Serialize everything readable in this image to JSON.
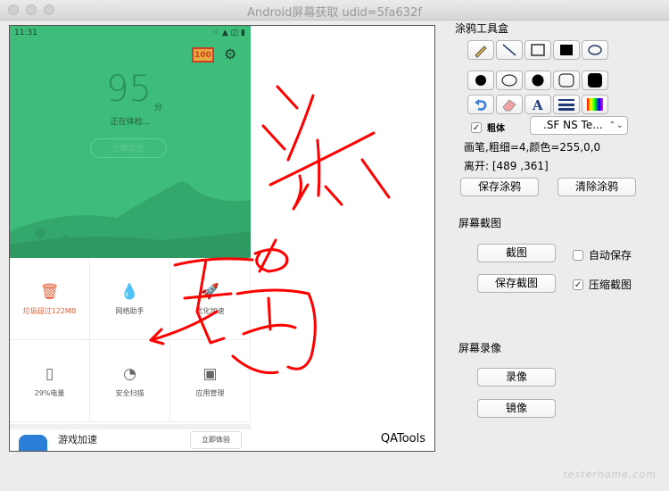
{
  "window": {
    "title": "Android屏幕获取 udid=5fa632f"
  },
  "phone": {
    "time": "11:31",
    "status_icons": "⁘ ▲ ◫ ▮",
    "badge": "100",
    "score": "95",
    "score_unit": "分",
    "checking": "正在体检...",
    "optimize_btn": "立即优化",
    "tiles": [
      {
        "label": "垃圾超过122MB",
        "icon": "trash-icon"
      },
      {
        "label": "网络助手",
        "icon": "drop-icon"
      },
      {
        "label": "优化加速",
        "icon": "rocket-icon"
      },
      {
        "label": "29%电量",
        "icon": "battery-icon"
      },
      {
        "label": "安全扫描",
        "icon": "scan-icon"
      },
      {
        "label": "应用管理",
        "icon": "android-icon"
      }
    ],
    "game": {
      "label": "游戏加速",
      "btn": "立即体验"
    }
  },
  "canvas": {
    "watermark": "QATools"
  },
  "toolbox": {
    "title": "涂鸦工具盒",
    "bold_label": "粗体",
    "bold_checked": true,
    "font_select": ".SF NS Te...",
    "pen_info": "画笔,粗细=4,颜色=255,0,0",
    "leave_info": "离开: [489 ,361]",
    "save_doodle": "保存涂鸦",
    "clear_doodle": "清除涂鸦"
  },
  "screenshot": {
    "title": "屏幕截图",
    "capture": "截图",
    "auto_save": "自动保存",
    "auto_save_checked": false,
    "save_capture": "保存截图",
    "compress": "压缩截图",
    "compress_checked": true
  },
  "record": {
    "title": "屏幕录像",
    "record_btn": "录像",
    "mirror_btn": "镜像"
  },
  "watermark": "testerhome.com",
  "colors": {
    "doodle": "#ff0000",
    "phone_green": "#3dbc7a",
    "orange": "#e8623a"
  }
}
